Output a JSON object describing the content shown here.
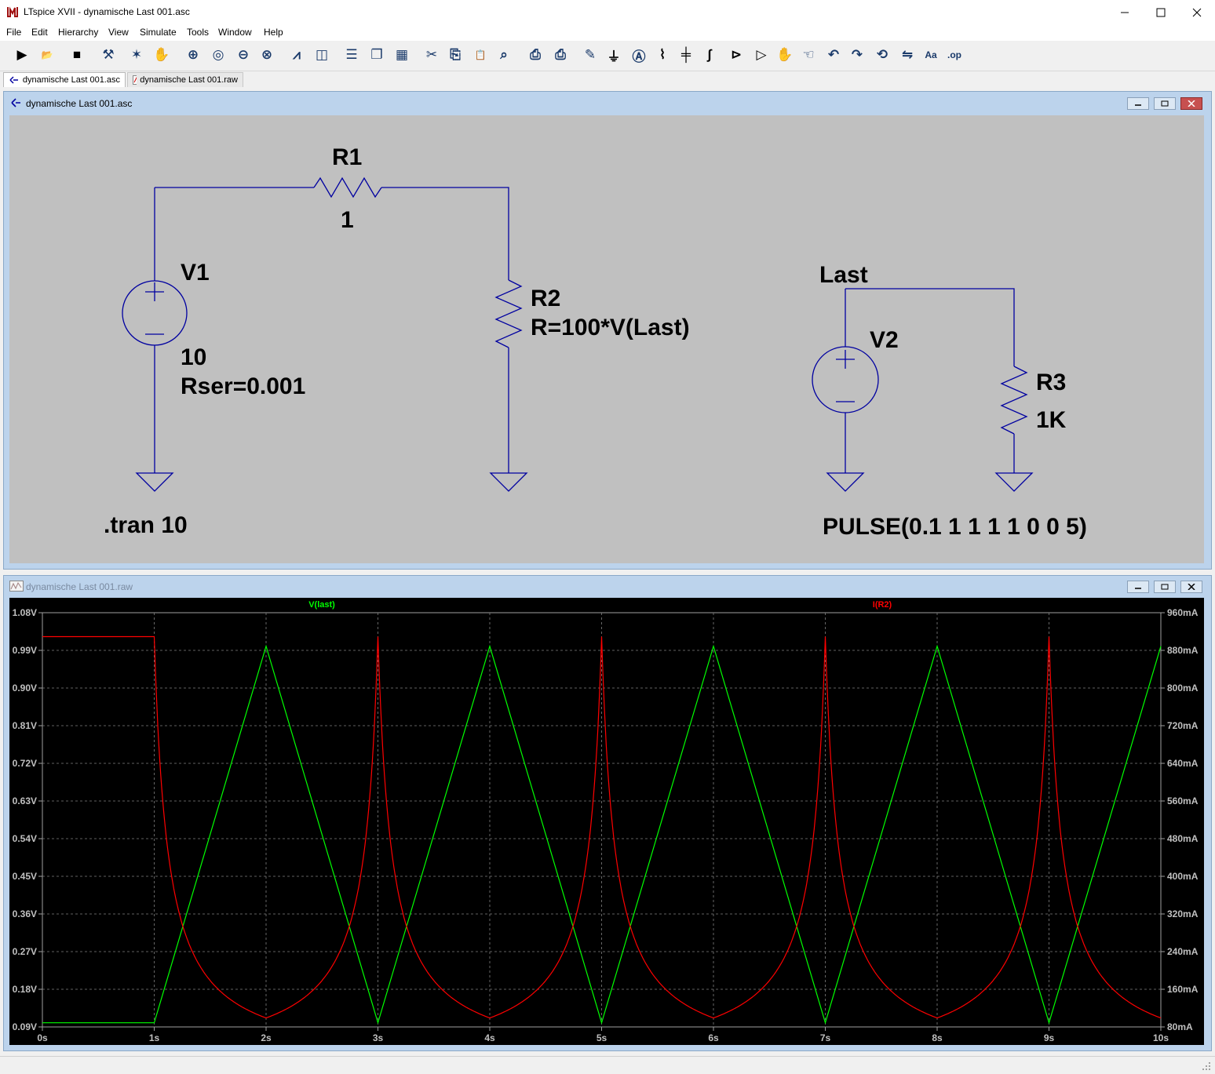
{
  "window": {
    "title": "LTspice XVII - dynamische Last 001.asc"
  },
  "menu": [
    "File",
    "Edit",
    "Hierarchy",
    "View",
    "Simulate",
    "Tools",
    "Window",
    "Help"
  ],
  "toolbar_icons": [
    "run-icon",
    "open-icon",
    "save-icon",
    "control-panel-icon",
    "halt-icon",
    "pan-icon",
    "zoom-in-icon",
    "zoom-fit-icon",
    "zoom-out-icon",
    "zoom-cancel-icon",
    "autorange-icon",
    "waveform-icon",
    "tile-horizontal-icon",
    "cascade-icon",
    "tile-vertical-icon",
    "cut-icon",
    "copy-icon",
    "paste-icon",
    "find-icon",
    "print-preview-icon",
    "print-icon",
    "wire-icon",
    "ground-icon",
    "label-net-icon",
    "resistor-icon",
    "capacitor-icon",
    "inductor-icon",
    "diode-icon",
    "component-icon",
    "move-icon",
    "drag-icon",
    "undo-icon",
    "redo-icon",
    "rotate-icon",
    "mirror-icon",
    "text-icon",
    "spice-directive-icon"
  ],
  "tabs": [
    {
      "label": "dynamische Last 001.asc",
      "active": true
    },
    {
      "label": "dynamische Last 001.raw",
      "active": false
    }
  ],
  "schematic": {
    "title": "dynamische Last 001.asc",
    "labels": {
      "r1_name": "R1",
      "r1_value": "1",
      "v1_name": "V1",
      "v1_value": "10",
      "v1_rser": "Rser=0.001",
      "r2_name": "R2",
      "r2_value": "R=100*V(Last)",
      "net_label": "Last",
      "v2_name": "V2",
      "r3_name": "R3",
      "r3_value": "1K",
      "tran_directive": ".tran 10",
      "pulse": "PULSE(0.1 1 1 1 1 0 0 5)"
    },
    "wire_color": "#0000a0",
    "background": "#c0c0c0"
  },
  "waveform": {
    "title": "dynamische Last 001.raw",
    "background": "#000000",
    "grid_color": "#808080"
  },
  "chart_data": {
    "type": "line",
    "xlabel": "",
    "ylabel": "",
    "x_ticks": [
      "0s",
      "1s",
      "2s",
      "3s",
      "4s",
      "5s",
      "6s",
      "7s",
      "8s",
      "9s",
      "10s"
    ],
    "xlim": [
      0,
      10
    ],
    "y_left_ticks": [
      "1.08V",
      "0.99V",
      "0.90V",
      "0.81V",
      "0.72V",
      "0.63V",
      "0.54V",
      "0.45V",
      "0.36V",
      "0.27V",
      "0.18V",
      "0.09V"
    ],
    "y_left_lim": [
      0.09,
      1.08
    ],
    "y_right_ticks": [
      "960mA",
      "880mA",
      "800mA",
      "720mA",
      "640mA",
      "560mA",
      "480mA",
      "400mA",
      "320mA",
      "240mA",
      "160mA",
      "80mA"
    ],
    "y_right_lim": [
      80,
      960
    ],
    "grid": true,
    "series": [
      {
        "name": "V(last)",
        "color": "#00ff00",
        "axis": "left",
        "unit": "V",
        "x": [
          0,
          1,
          2,
          3,
          4,
          5,
          6,
          7,
          8,
          9,
          10
        ],
        "y": [
          0.1,
          0.1,
          1.0,
          0.1,
          1.0,
          0.1,
          1.0,
          0.1,
          1.0,
          0.1,
          1.0
        ]
      },
      {
        "name": "I(R2)",
        "color": "#ff0000",
        "axis": "right",
        "unit": "mA",
        "x": [
          0,
          1,
          1.5,
          2,
          2.5,
          3,
          3.5,
          4,
          4.5,
          5,
          5.5,
          6,
          6.5,
          7,
          7.5,
          8,
          8.5,
          9,
          9.5,
          10
        ],
        "y": [
          909,
          909,
          166,
          99,
          166,
          909,
          166,
          99,
          166,
          909,
          166,
          99,
          166,
          909,
          166,
          99,
          166,
          909,
          166,
          99
        ]
      }
    ]
  }
}
